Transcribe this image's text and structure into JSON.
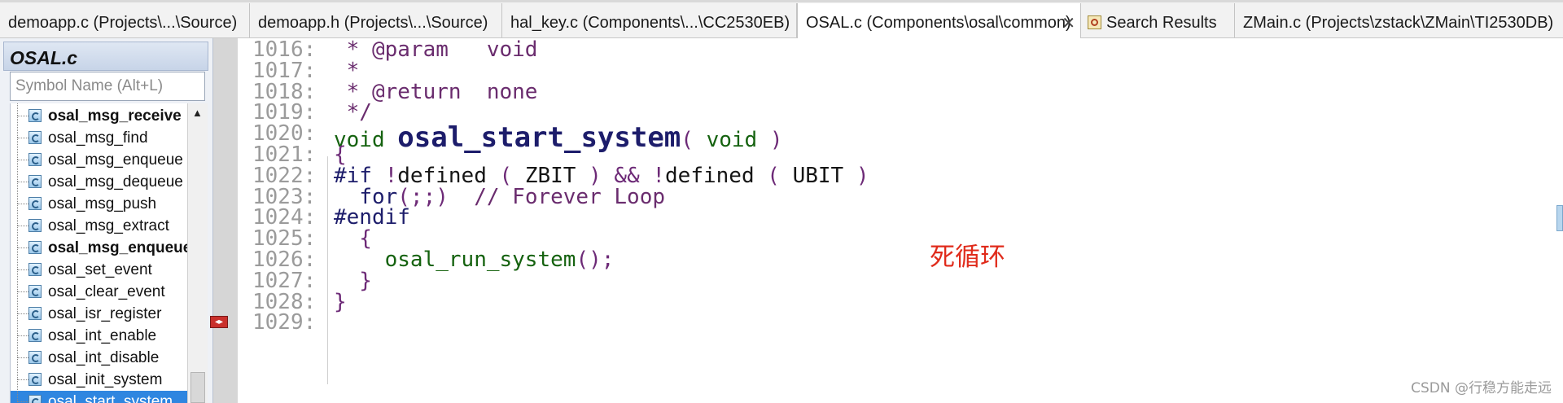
{
  "tabs": [
    {
      "label": "demoapp.c (Projects\\...\\Source)",
      "active": false
    },
    {
      "label": "demoapp.h (Projects\\...\\Source)",
      "active": false
    },
    {
      "label": "hal_key.c (Components\\...\\CC2530EB)",
      "active": false
    },
    {
      "label": "OSAL.c (Components\\osal\\common)",
      "active": true,
      "close": "✕"
    },
    {
      "label": "Search Results",
      "active": false
    },
    {
      "label": "ZMain.c (Projects\\zstack\\ZMain\\TI2530DB)",
      "active": false
    }
  ],
  "symbols": {
    "title": "OSAL.c",
    "search_placeholder": "Symbol Name (Alt+L)",
    "items": [
      {
        "label": "osal_msg_receive",
        "bold": true
      },
      {
        "label": "osal_msg_find",
        "bold": false
      },
      {
        "label": "osal_msg_enqueue",
        "bold": false
      },
      {
        "label": "osal_msg_dequeue",
        "bold": false
      },
      {
        "label": "osal_msg_push",
        "bold": false
      },
      {
        "label": "osal_msg_extract",
        "bold": false
      },
      {
        "label": "osal_msg_enqueue",
        "bold": true
      },
      {
        "label": "osal_set_event",
        "bold": false
      },
      {
        "label": "osal_clear_event",
        "bold": false
      },
      {
        "label": "osal_isr_register",
        "bold": false
      },
      {
        "label": "osal_int_enable",
        "bold": false
      },
      {
        "label": "osal_int_disable",
        "bold": false
      },
      {
        "label": "osal_init_system",
        "bold": false
      },
      {
        "label": "osal_start_system",
        "bold": false,
        "selected": true
      }
    ]
  },
  "editor": {
    "lines": [
      {
        "num": "1016:",
        "parts": [
          [
            "cm",
            " * @param   void"
          ]
        ]
      },
      {
        "num": "1017:",
        "parts": [
          [
            "cm",
            " *"
          ]
        ]
      },
      {
        "num": "1018:",
        "parts": [
          [
            "cm",
            " * @return  none"
          ]
        ]
      },
      {
        "num": "1019:",
        "parts": [
          [
            "cm",
            " */"
          ]
        ]
      },
      {
        "num": "1020:",
        "parts": [
          [
            "kw",
            "void "
          ],
          [
            "fnbig",
            "osal_start_system"
          ],
          [
            "pu",
            "( "
          ],
          [
            "kw",
            "void"
          ],
          [
            "pu",
            " )"
          ]
        ]
      },
      {
        "num": "1021:",
        "parts": [
          [
            "pu",
            "{"
          ]
        ]
      },
      {
        "num": "1022:",
        "parts": [
          [
            "pp",
            "#if "
          ],
          [
            "pu",
            "!"
          ],
          [
            "id",
            "defined "
          ],
          [
            "pu",
            "( "
          ],
          [
            "id",
            "ZBIT "
          ],
          [
            "pu",
            ") && !"
          ],
          [
            "id",
            "defined "
          ],
          [
            "pu",
            "( "
          ],
          [
            "id",
            "UBIT "
          ],
          [
            "pu",
            ")"
          ]
        ]
      },
      {
        "num": "1023:",
        "parts": [
          [
            "id",
            "  "
          ],
          [
            "pp",
            "for"
          ],
          [
            "pu",
            "(;;)  "
          ],
          [
            "cm",
            "// Forever Loop"
          ]
        ]
      },
      {
        "num": "1024:",
        "parts": [
          [
            "pp",
            "#endif"
          ]
        ]
      },
      {
        "num": "1025:",
        "parts": [
          [
            "pu",
            "  {"
          ]
        ]
      },
      {
        "num": "1026:",
        "parts": [
          [
            "id",
            "    "
          ],
          [
            "fncall",
            "osal_run_system"
          ],
          [
            "pu",
            "();"
          ]
        ]
      },
      {
        "num": "1027:",
        "parts": [
          [
            "pu",
            "  }"
          ]
        ]
      },
      {
        "num": "1028:",
        "parts": [
          [
            "pu",
            "}"
          ]
        ]
      },
      {
        "num": "1029:",
        "parts": []
      }
    ],
    "annotation": "死循环"
  },
  "watermark": "CSDN @行稳方能走远",
  "colors": {
    "comment": "#6a2c6e",
    "keyword": "#15620f",
    "function_name": "#1d1d6b",
    "annotation": "#e02b1b",
    "selection": "#2f86e0"
  }
}
